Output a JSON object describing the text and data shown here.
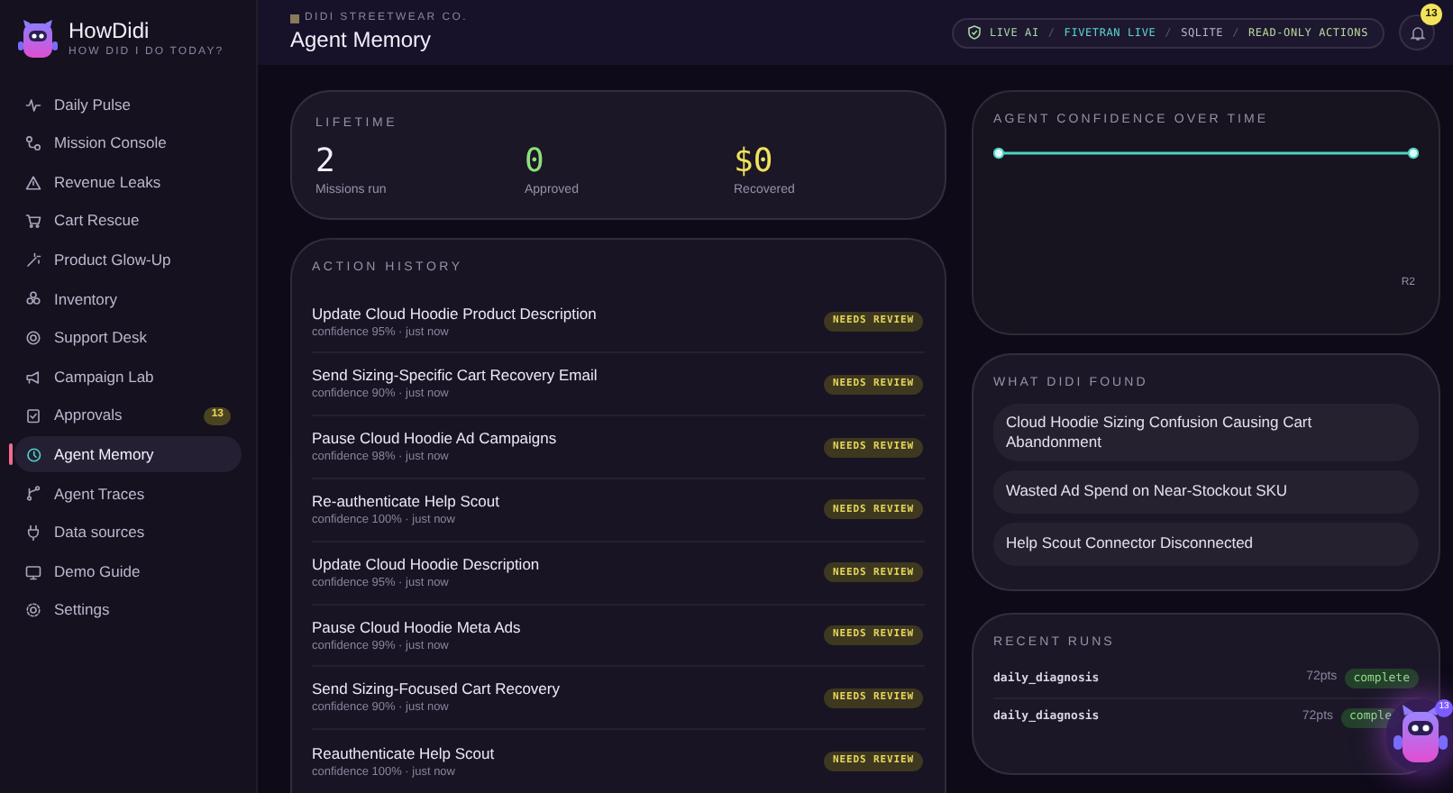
{
  "sidebar": {
    "brand": "HowDidi",
    "tagline": "HOW DID I DO TODAY?",
    "items": [
      {
        "label": "Daily Pulse",
        "selected": false
      },
      {
        "label": "Mission Console",
        "selected": false
      },
      {
        "label": "Revenue Leaks",
        "selected": false
      },
      {
        "label": "Cart Rescue",
        "selected": false
      },
      {
        "label": "Product Glow-Up",
        "selected": false
      },
      {
        "label": "Inventory",
        "selected": false
      },
      {
        "label": "Support Desk",
        "selected": false
      },
      {
        "label": "Campaign Lab",
        "selected": false
      },
      {
        "label": "Approvals",
        "selected": false,
        "badge": "13"
      },
      {
        "label": "Agent Memory",
        "selected": true
      },
      {
        "label": "Agent Traces",
        "selected": false
      },
      {
        "label": "Data sources",
        "selected": false
      },
      {
        "label": "Demo Guide",
        "selected": false
      },
      {
        "label": "Settings",
        "selected": false
      }
    ]
  },
  "header": {
    "breadcrumb": "DIDI STREETWEAR CO.",
    "title": "Agent Memory",
    "status": [
      {
        "kind": "label",
        "text": "LIVE AI",
        "color": "#a7d7a0"
      },
      {
        "kind": "separator",
        "text": "/"
      },
      {
        "kind": "label",
        "text": "FIVETRAN LIVE",
        "color": "#5fd3d0"
      },
      {
        "kind": "separator",
        "text": "/"
      },
      {
        "kind": "label",
        "text": "SQLITE",
        "color": "#b8b4c8"
      },
      {
        "kind": "separator",
        "text": "/"
      },
      {
        "kind": "label",
        "text": "READ-ONLY ACTIONS",
        "color": "#b9d79a"
      }
    ],
    "notifications": "13"
  },
  "lifetime": {
    "title": "LIFETIME",
    "stats": [
      {
        "value": "2",
        "label": "Missions run",
        "color": "#f1eff7"
      },
      {
        "value": "0",
        "label": "Approved",
        "color": "#8ee07a"
      },
      {
        "value": "$0",
        "label": "Recovered",
        "color": "#f1e35a"
      }
    ]
  },
  "action_history": {
    "title": "ACTION HISTORY",
    "rows": [
      {
        "title": "Update Cloud Hoodie Product Description",
        "meta": "confidence 95% · just now",
        "status": "NEEDS REVIEW"
      },
      {
        "title": "Send Sizing-Specific Cart Recovery Email",
        "meta": "confidence 90% · just now",
        "status": "NEEDS REVIEW"
      },
      {
        "title": "Pause Cloud Hoodie Ad Campaigns",
        "meta": "confidence 98% · just now",
        "status": "NEEDS REVIEW"
      },
      {
        "title": "Re-authenticate Help Scout",
        "meta": "confidence 100% · just now",
        "status": "NEEDS REVIEW"
      },
      {
        "title": "Update Cloud Hoodie Description",
        "meta": "confidence 95% · just now",
        "status": "NEEDS REVIEW"
      },
      {
        "title": "Pause Cloud Hoodie Meta Ads",
        "meta": "confidence 99% · just now",
        "status": "NEEDS REVIEW"
      },
      {
        "title": "Send Sizing-Focused Cart Recovery",
        "meta": "confidence 90% · just now",
        "status": "NEEDS REVIEW"
      },
      {
        "title": "Reauthenticate Help Scout",
        "meta": "confidence 100% · just now",
        "status": "NEEDS REVIEW"
      }
    ]
  },
  "confidence": {
    "title": "AGENT CONFIDENCE OVER TIME",
    "x_label": "R2"
  },
  "findings": {
    "title": "WHAT DIDI FOUND",
    "items": [
      "Cloud Hoodie Sizing Confusion Causing Cart Abandonment",
      "Wasted Ad Spend on Near-Stockout SKU",
      "Help Scout Connector Disconnected"
    ]
  },
  "recent_runs": {
    "title": "RECENT RUNS",
    "rows": [
      {
        "name": "daily_diagnosis",
        "points": "72pts",
        "status": "complete"
      },
      {
        "name": "daily_diagnosis",
        "points": "72pts",
        "status": "comple"
      }
    ]
  },
  "assistant": {
    "badge": "13"
  }
}
